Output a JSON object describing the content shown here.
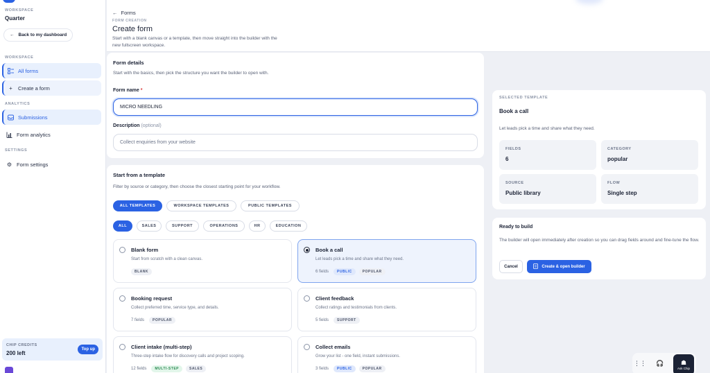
{
  "sidebar": {
    "workspace_label": "WORKSPACE",
    "workspace_name": "Quarter",
    "back_label": "Back to my dashboard",
    "section_workspace": "WORKSPACE",
    "section_analytics": "ANALYTICS",
    "section_settings": "SETTINGS",
    "items": [
      {
        "label": "All forms",
        "icon": "list-icon"
      },
      {
        "label": "Create a form",
        "icon": "plus-icon"
      },
      {
        "label": "Submissions",
        "icon": "inbox-icon"
      },
      {
        "label": "Form analytics",
        "icon": "bar-chart-icon"
      },
      {
        "label": "Form settings",
        "icon": "gear-icon"
      }
    ],
    "credits_label": "CHIP CREDITS",
    "credits_value": "200 left",
    "topup_label": "Top up"
  },
  "header": {
    "breadcrumb": "Forms",
    "eyebrow": "FORM CREATION",
    "title": "Create form",
    "subtitle": "Start with a blank canvas or a template, then move straight into the builder with the new fullscreen workspace."
  },
  "details": {
    "title": "Form details",
    "subtitle": "Start with the basics, then pick the structure you want the builder to open with.",
    "name_label": "Form name",
    "name_required": "*",
    "name_value": "MICRO NEEDLING",
    "desc_label": "Description",
    "desc_optional": "(optional)",
    "desc_placeholder": "Collect enquiries from your website"
  },
  "templates": {
    "title": "Start from a template",
    "subtitle": "Filter by source or category, then choose the closest starting point for your workflow.",
    "source_filters": [
      "ALL TEMPLATES",
      "WORKSPACE TEMPLATES",
      "PUBLIC TEMPLATES"
    ],
    "category_filters": [
      "ALL",
      "SALES",
      "SUPPORT",
      "OPERATIONS",
      "HR",
      "EDUCATION"
    ],
    "cards": [
      {
        "name": "Blank form",
        "desc": "Start from scratch with a clean canvas.",
        "count": "",
        "tags": [
          "BLANK"
        ]
      },
      {
        "name": "Book a call",
        "desc": "Let leads pick a time and share what they need.",
        "count": "6 fields",
        "tags": [
          "PUBLIC",
          "POPULAR"
        ]
      },
      {
        "name": "Booking request",
        "desc": "Collect preferred time, service type, and details.",
        "count": "7 fields",
        "tags": [
          "POPULAR"
        ]
      },
      {
        "name": "Client feedback",
        "desc": "Collect ratings and testimonials from clients.",
        "count": "5 fields",
        "tags": [
          "SUPPORT"
        ]
      },
      {
        "name": "Client intake (multi-step)",
        "desc": "Three-step intake flow for discovery calls and project scoping.",
        "count": "12 fields",
        "tags": [
          "MULTI-STEP",
          "SALES"
        ]
      },
      {
        "name": "Collect emails",
        "desc": "Grow your list - one field, instant submissions.",
        "count": "3 fields",
        "tags": [
          "PUBLIC",
          "POPULAR"
        ]
      }
    ]
  },
  "selected": {
    "eyebrow": "SELECTED TEMPLATE",
    "name": "Book a call",
    "desc": "Let leads pick a time and share what they need.",
    "stats": [
      {
        "k": "FIELDS",
        "v": "6"
      },
      {
        "k": "CATEGORY",
        "v": "popular"
      },
      {
        "k": "SOURCE",
        "v": "Public library"
      },
      {
        "k": "FLOW",
        "v": "Single step"
      }
    ]
  },
  "ready": {
    "title": "Ready to build",
    "desc": "The builder will open immediately after creation so you can drag fields around and fine-tune the flow.",
    "cancel_label": "Cancel",
    "create_label": "Create & open builder"
  },
  "dock": {
    "chip_label": "Ask Chip"
  },
  "colors": {
    "accent": "#2b62e3",
    "bg": "#eef0f5",
    "text": "#1b2235"
  }
}
